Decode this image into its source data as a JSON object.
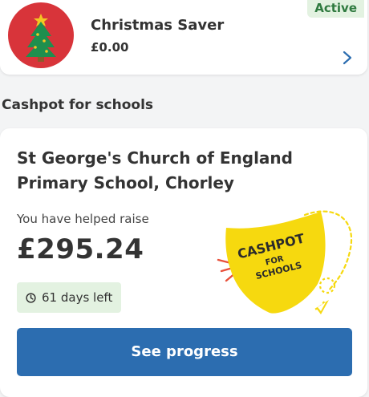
{
  "saver": {
    "title": "Christmas Saver",
    "amount": "£0.00",
    "status": "Active",
    "avatar_icon": "christmas-tree-icon",
    "avatar_color": "#d8343a"
  },
  "section": {
    "heading": "Cashpot for schools"
  },
  "school": {
    "name": "St George's Church of England Primary School, Chorley",
    "raise_label": "You have helped raise",
    "amount": "£295.24",
    "days_left": "61 days left",
    "button_label": "See progress",
    "logo": {
      "line1": "CASHPOT",
      "line2": "FOR",
      "line3": "SCHOOLS"
    }
  },
  "colors": {
    "primary_button": "#2c6db0",
    "badge_bg": "#e3f2e1",
    "badge_text": "#2f7a3f",
    "logo_yellow": "#f6d90f"
  }
}
